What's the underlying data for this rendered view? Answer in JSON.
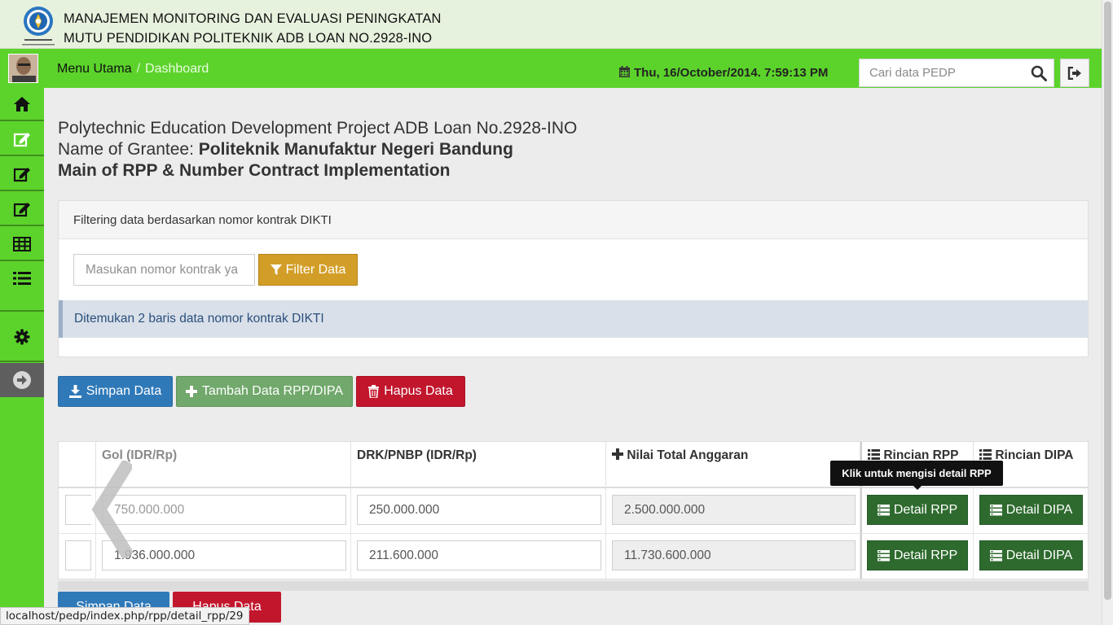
{
  "app": {
    "title_line1": "MANAJEMEN MONITORING DAN EVALUASI PENINGKATAN",
    "title_line2": "MUTU PENDIDIKAN POLITEKNIK ADB LOAN NO.2928-INO"
  },
  "topbar": {
    "breadcrumb_home": "Menu Utama",
    "breadcrumb_sep": "/",
    "breadcrumb_current": "Dashboard",
    "datetime": "Thu, 16/October/2014. 7:59:13 PM",
    "search_placeholder": "Cari data PEDP",
    "accent_color": "#5cd32b"
  },
  "sidebar": {
    "items": [
      {
        "icon": "home-icon"
      },
      {
        "icon": "edit-icon"
      },
      {
        "icon": "edit-icon"
      },
      {
        "icon": "edit-icon"
      },
      {
        "icon": "table-icon"
      },
      {
        "icon": "list-icon"
      },
      {
        "icon": "gear-icon"
      }
    ],
    "toggle_icon": "arrow-circle-right-icon"
  },
  "heading": {
    "line1": "Polytechnic Education Development Project ADB Loan No.2928-INO",
    "line2_prefix": "Name of Grantee: ",
    "line2_value": "Politeknik Manufaktur Negeri Bandung",
    "line3": "Main of RPP & Number Contract Implementation"
  },
  "filter": {
    "panel_title": "Filtering data berdasarkan nomor kontrak DIKTI",
    "input_placeholder": "Masukan nomor kontrak ya",
    "button_label": "Filter Data",
    "result_text": "Ditemukan 2 baris data nomor kontrak DIKTI"
  },
  "actions": {
    "save_label": "Simpan Data",
    "add_label": "Tambah Data RPP/DIPA",
    "delete_label": "Hapus Data"
  },
  "table": {
    "headers": {
      "gol": "Gol (IDR/Rp)",
      "drk": "DRK/PNBP (IDR/Rp)",
      "total": "Nilai Total Anggaran",
      "rincian_rpp": "Rincian RPP",
      "rincian_dipa": "Rincian DIPA"
    },
    "rows": [
      {
        "gol": "750.000.000",
        "drk": "250.000.000",
        "total": "2.500.000.000",
        "rpp_btn": "Detail RPP",
        "dipa_btn": "Detail DIPA"
      },
      {
        "gol": "1.936.000.000",
        "drk": "211.600.000",
        "total": "11.730.600.000",
        "rpp_btn": "Detail RPP",
        "dipa_btn": "Detail DIPA"
      }
    ]
  },
  "tooltip": "Klik untuk mengisi detail RPP",
  "status_url": "localhost/pedp/index.php/rpp/detail_rpp/29"
}
